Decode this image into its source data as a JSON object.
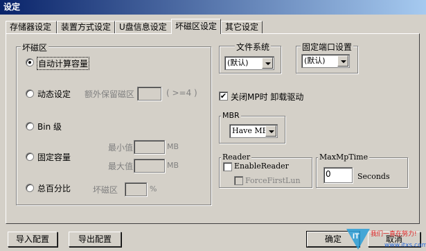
{
  "window": {
    "title": "设定"
  },
  "tabs": [
    "存储器设定",
    "装置方式设定",
    "U盘信息设定",
    "坏磁区设定",
    "其它设定"
  ],
  "bad_sector": {
    "legend": "坏磁区",
    "auto_label": "自动计算容量",
    "dynamic_label": "动态设定",
    "extra_reserved_label": "额外保留磁区",
    "extra_reserved_hint": "( >=4 )",
    "bin_label": "Bin 级",
    "fixed_label": "固定容量",
    "min_label": "最小值",
    "max_label": "最大值",
    "unit_mb": "MB",
    "percent_label": "总百分比",
    "percent_field_label": "坏磁区",
    "percent_unit": "%"
  },
  "filesystem": {
    "legend": "文件系统",
    "value": "(默认)"
  },
  "fixed_port": {
    "legend": "固定端口设置",
    "value": "(默认)"
  },
  "unload_check": {
    "label": "关闭MP时 卸载驱动",
    "checked": true
  },
  "mbr": {
    "legend": "MBR",
    "value": "Have MBR"
  },
  "reader": {
    "legend": "Reader",
    "enable_label": "EnableReader",
    "force_label": "ForceFirstLun"
  },
  "maxmp": {
    "legend": "MaxMpTime",
    "value": "0",
    "unit": "Seconds"
  },
  "footer": {
    "import": "导入配置",
    "export": "导出配置",
    "ok": "确定",
    "cancel": "取消"
  },
  "watermark": {
    "line1": "我们一直在努力!",
    "line2": "www.itxs.com",
    "logo": "IT"
  }
}
